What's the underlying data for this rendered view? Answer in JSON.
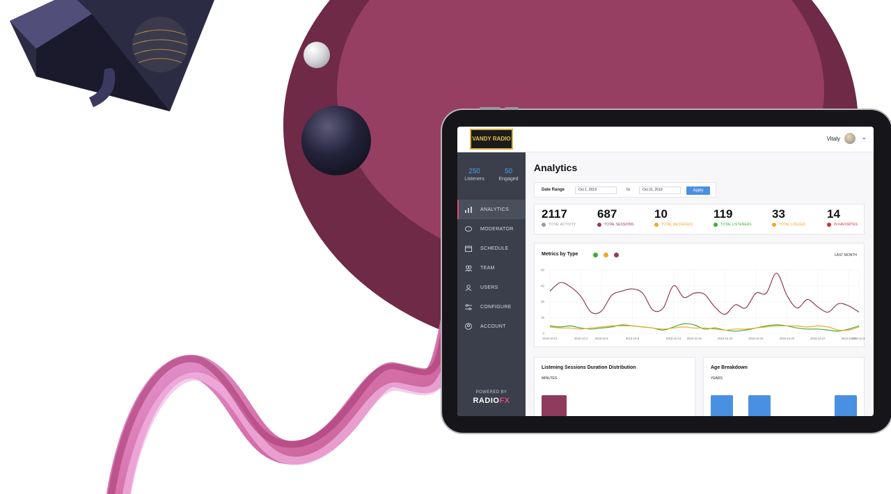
{
  "header": {
    "logo_text": "VANDY RADIO",
    "user_name": "Vitaly"
  },
  "sidebar": {
    "stats": [
      {
        "value": "250",
        "label": "Listeners"
      },
      {
        "value": "50",
        "label": "Engaged"
      }
    ],
    "items": [
      {
        "label": "ANALYTICS",
        "icon": "bar-chart-icon",
        "active": true
      },
      {
        "label": "MODERATOR",
        "icon": "chat-bubble-icon",
        "active": false
      },
      {
        "label": "SCHEDULE",
        "icon": "calendar-icon",
        "active": false
      },
      {
        "label": "TEAM",
        "icon": "team-icon",
        "active": false
      },
      {
        "label": "USERS",
        "icon": "user-icon",
        "active": false
      },
      {
        "label": "CONFIGURE",
        "icon": "sliders-icon",
        "active": false
      },
      {
        "label": "ACCOUNT",
        "icon": "account-icon",
        "active": false
      }
    ],
    "powered_by": "POWERED BY",
    "brand_main": "RADIO",
    "brand_suffix": "FX"
  },
  "main": {
    "title": "Analytics",
    "date_range": {
      "label": "Date Range",
      "from": "Oct 1, 2019",
      "to_label": "to",
      "to": "Oct 31, 2019",
      "apply_label": "Apply"
    },
    "metrics": [
      {
        "value": "2117",
        "label": "TOTAL ACTIVITY",
        "color": "#9a9a9a"
      },
      {
        "value": "687",
        "label": "TOTAL SESSIONS",
        "color": "#8e3b5d"
      },
      {
        "value": "10",
        "label": "TOTAL MESSAGES",
        "color": "#f5a623"
      },
      {
        "value": "119",
        "label": "TOTAL LISTENERS",
        "color": "#3ab03e"
      },
      {
        "value": "33",
        "label": "TOTAL LOGGED",
        "color": "#f5a623"
      },
      {
        "value": "14",
        "label": "IN FAVORITES",
        "color": "#d0312d"
      }
    ],
    "chart": {
      "title": "Metrics by Type",
      "period": "LAST MONTH"
    },
    "sessions_card": {
      "title": "Listening Sessions Duration Distribution",
      "subtitle": "MINUTES"
    },
    "age_card": {
      "title": "Age Breakdown",
      "subtitle": "YEARS"
    }
  },
  "colors": {
    "sidebar_bg": "#3a3f4b",
    "accent_blue": "#4a90e2",
    "series_sessions": "#8e3b5d",
    "series_listeners": "#3ab03e",
    "series_messages": "#f5a623"
  },
  "chart_data": {
    "type": "line",
    "x": [
      "2019-10-01",
      "2019-10-02",
      "2019-10-03",
      "2019-10-04",
      "2019-10-05",
      "2019-10-06",
      "2019-10-07",
      "2019-10-08",
      "2019-10-09",
      "2019-10-10",
      "2019-10-11",
      "2019-10-12",
      "2019-10-13",
      "2019-10-14",
      "2019-10-15",
      "2019-10-16",
      "2019-10-17",
      "2019-10-18",
      "2019-10-19",
      "2019-10-20",
      "2019-10-21",
      "2019-10-22",
      "2019-10-23",
      "2019-10-24",
      "2019-10-25",
      "2019-10-26",
      "2019-10-27",
      "2019-10-28",
      "2019-10-29",
      "2019-10-30",
      "2019-10-31"
    ],
    "tick_labels": [
      "2019-10-01",
      "2019-10-4",
      "2019-10-6",
      "2019-10-9",
      "2019-10-13",
      "2019-10-15",
      "2019-10-18",
      "2019-10-21",
      "2019-10-24",
      "2019-10-27",
      "2019-10-30",
      "2019-10-31"
    ],
    "tick_indices": [
      0,
      3,
      5,
      8,
      12,
      14,
      17,
      20,
      23,
      26,
      29,
      30
    ],
    "ylim": [
      0,
      60
    ],
    "yticks": [
      0,
      15,
      30,
      45,
      60
    ],
    "grid": true,
    "series": [
      {
        "color": "#8e3b5d",
        "values": [
          40,
          48,
          44,
          35,
          20,
          21,
          36,
          40,
          42,
          38,
          22,
          24,
          45,
          34,
          38,
          37,
          25,
          18,
          27,
          24,
          38,
          38,
          57,
          36,
          24,
          32,
          25,
          20,
          28,
          26,
          20
        ]
      },
      {
        "color": "#3ab03e",
        "values": [
          7,
          6,
          7,
          5,
          4,
          5,
          6,
          8,
          7,
          6,
          5,
          3,
          6,
          9,
          8,
          4,
          5,
          3,
          2,
          3,
          5,
          7,
          8,
          7,
          5,
          4,
          4,
          3,
          2,
          4,
          7
        ]
      },
      {
        "color": "#f5a623",
        "values": [
          6,
          5,
          5,
          4,
          5,
          6,
          7,
          7,
          7,
          6,
          5,
          4,
          5,
          6,
          5,
          5,
          4,
          3,
          4,
          4,
          5,
          6,
          7,
          7,
          7,
          6,
          7,
          6,
          3,
          3,
          6
        ]
      }
    ]
  },
  "sessions_bars": [
    {
      "value": 1.0,
      "color": "#8e3b5d"
    }
  ],
  "age_bars": [
    {
      "value": 1.0,
      "color": "#4a90e2"
    },
    {
      "value": 1.0,
      "color": "#4a90e2"
    },
    {
      "value": 1.0,
      "color": "#4a90e2"
    }
  ]
}
